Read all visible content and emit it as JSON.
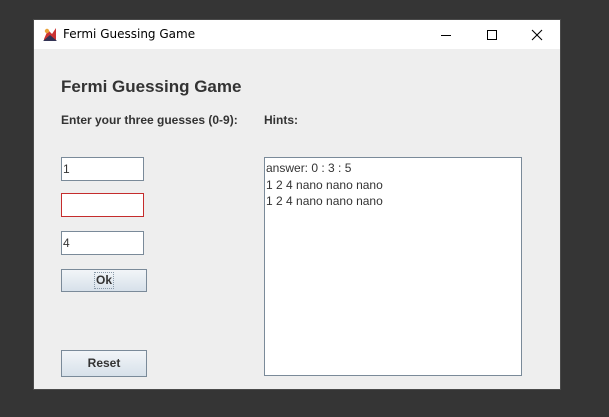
{
  "window": {
    "title": "Fermi Guessing Game",
    "controls": {
      "minimize_icon": "minimize-icon",
      "maximize_icon": "maximize-icon",
      "close_icon": "close-icon"
    }
  },
  "main": {
    "heading": "Fermi Guessing Game",
    "guess_label": "Enter your three guesses (0-9):",
    "hints_label": "Hints:",
    "guesses": [
      {
        "value": "1"
      },
      {
        "value": ""
      },
      {
        "value": "4"
      }
    ],
    "ok_label": "Ok",
    "reset_label": "Reset",
    "hints": [
      "answer: 0 : 3 : 5",
      "1 2 4 nano nano nano",
      "1 2 4 nano nano nano"
    ]
  },
  "colors": {
    "window_bg": "#eeeeee",
    "desktop_bg": "#353535",
    "field_border": "#7a8a99",
    "error_border": "#c52c2c",
    "text": "#333333"
  }
}
